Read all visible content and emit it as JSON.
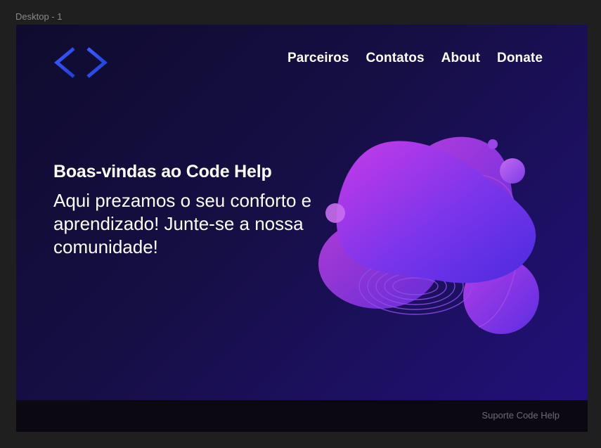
{
  "canvas": {
    "frame_label": "Desktop - 1"
  },
  "header": {
    "logo_icon": "code-brackets-icon",
    "nav": [
      {
        "label": "Parceiros"
      },
      {
        "label": "Contatos"
      },
      {
        "label": "About"
      },
      {
        "label": "Donate"
      }
    ]
  },
  "hero": {
    "title": "Boas-vindas ao Code Help",
    "subtitle": "Aqui prezamos o seu conforto e aprendizado! Junte-se a nossa comunidade!",
    "illustration_icon": "abstract-blob-illustration"
  },
  "footer": {
    "text": "Suporte Code Help"
  },
  "colors": {
    "background_dark": "#0f0b2e",
    "background_light": "#22107a",
    "logo_blue": "#2f4ff0",
    "blob_magenta": "#c03be6",
    "blob_violet": "#5a2ee6",
    "footer_bg": "#0c0812"
  }
}
